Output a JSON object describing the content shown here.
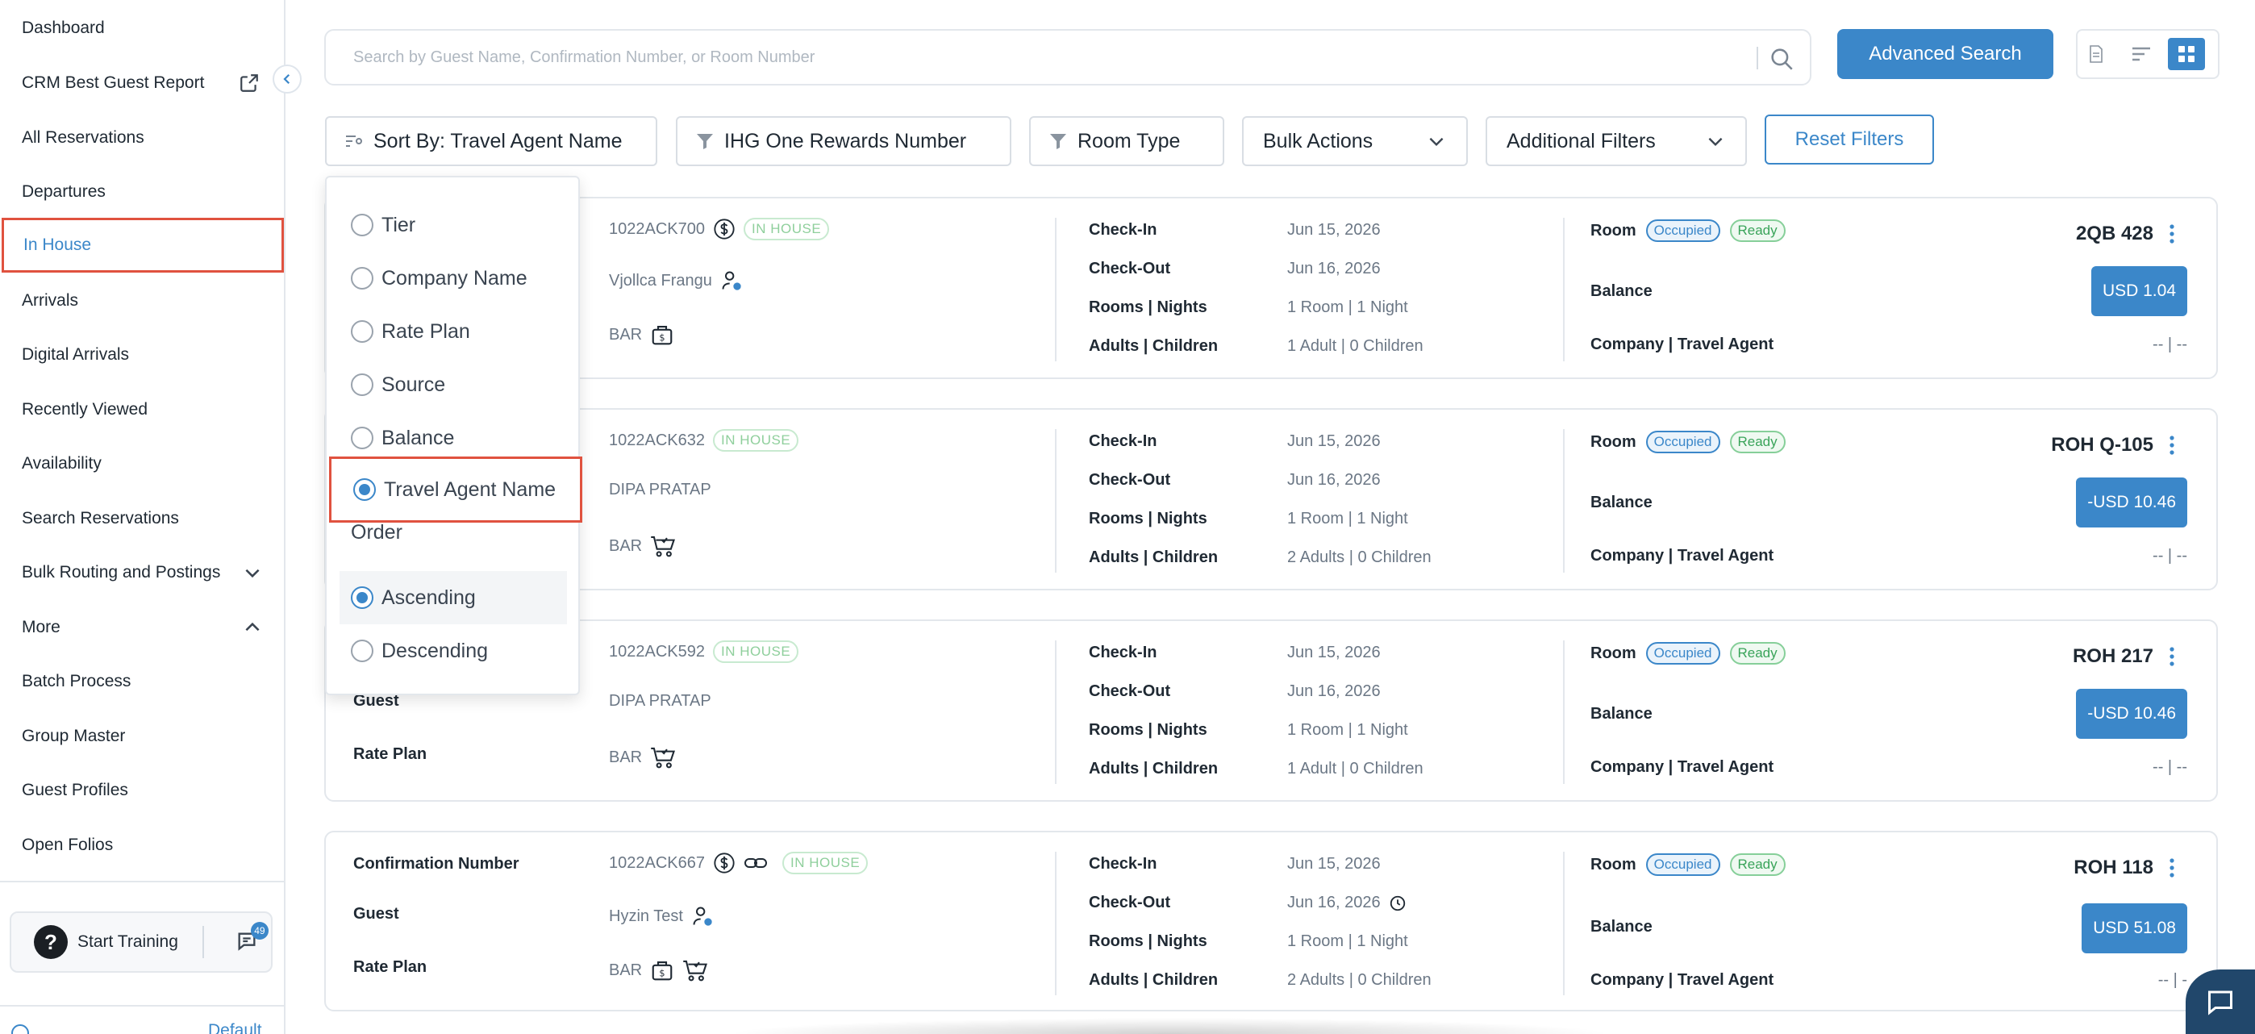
{
  "sidebar": {
    "items": [
      {
        "label": "Dashboard"
      },
      {
        "label": "CRM Best Guest Report"
      },
      {
        "label": "All Reservations"
      },
      {
        "label": "Departures"
      },
      {
        "label": "In House"
      },
      {
        "label": "Arrivals"
      },
      {
        "label": "Digital Arrivals"
      },
      {
        "label": "Recently Viewed"
      },
      {
        "label": "Availability"
      },
      {
        "label": "Search Reservations"
      },
      {
        "label": "Bulk Routing and Postings"
      },
      {
        "label": "More"
      },
      {
        "label": "Batch Process"
      },
      {
        "label": "Group Master"
      },
      {
        "label": "Guest Profiles"
      },
      {
        "label": "Open Folios"
      }
    ],
    "active": "In House",
    "training_label": "Start Training",
    "chat_badge": "49",
    "footer_default": "Default"
  },
  "search": {
    "placeholder": "Search by Guest Name, Confirmation Number, or Room Number",
    "advanced_label": "Advanced Search"
  },
  "filters": {
    "sort_label": "Sort By: Travel Agent Name",
    "rewards_label": "IHG One Rewards Number",
    "room_type_label": "Room Type",
    "bulk_actions_label": "Bulk Actions",
    "additional_filters_label": "Additional Filters",
    "reset_label": "Reset Filters"
  },
  "sort_panel": {
    "options": [
      "Tier",
      "Company Name",
      "Rate Plan",
      "Source",
      "Balance",
      "Travel Agent Name"
    ],
    "selected": "Travel Agent Name",
    "order_label": "Order",
    "order_options": [
      "Ascending",
      "Descending"
    ],
    "order_selected": "Ascending"
  },
  "labels": {
    "confirmation": "Confirmation Number",
    "guest": "Guest",
    "rate_plan": "Rate Plan",
    "check_in": "Check-In",
    "check_out": "Check-Out",
    "rooms_nights": "Rooms | Nights",
    "adults_children": "Adults | Children",
    "room": "Room",
    "balance": "Balance",
    "company_ta": "Company | Travel Agent",
    "in_house_tag": "IN HOUSE",
    "occupied_tag": "Occupied",
    "ready_tag": "Ready"
  },
  "reservations": [
    {
      "confirmation": "1022ACK700",
      "guest": "Vjollca Frangu",
      "rate_plan": "BAR",
      "check_in": "Jun 15, 2026",
      "check_out": "Jun 16, 2026",
      "rooms_nights": "1 Room | 1 Night",
      "adults_children": "1 Adult | 0 Children",
      "room": "2QB  428",
      "balance": "USD 1.04",
      "company_ta": "-- | --"
    },
    {
      "confirmation": "1022ACK632",
      "guest": "DIPA PRATAP",
      "rate_plan": "BAR",
      "check_in": "Jun 15, 2026",
      "check_out": "Jun 16, 2026",
      "rooms_nights": "1 Room | 1 Night",
      "adults_children": "2 Adults | 0 Children",
      "room": "ROH  Q-105",
      "balance": "-USD 10.46",
      "company_ta": "-- | --"
    },
    {
      "confirmation": "1022ACK592",
      "guest": "DIPA PRATAP",
      "rate_plan": "BAR",
      "check_in": "Jun 15, 2026",
      "check_out": "Jun 16, 2026",
      "rooms_nights": "1 Room | 1 Night",
      "adults_children": "1 Adult | 0 Children",
      "room": "ROH  217",
      "balance": "-USD 10.46",
      "company_ta": "-- | --"
    },
    {
      "confirmation": "1022ACK667",
      "guest": "Hyzin Test",
      "rate_plan": "BAR",
      "check_in": "Jun 15, 2026",
      "check_out": "Jun 16, 2026",
      "rooms_nights": "1 Room | 1 Night",
      "adults_children": "2 Adults | 0 Children",
      "room": "ROH  118",
      "balance": "USD 51.08",
      "company_ta": "-- | -"
    }
  ],
  "colors": {
    "accent": "#3b87c9",
    "highlight": "#e0523f",
    "in_house": "#8fcf9c",
    "ready": "#3aa45a"
  },
  "icons": [
    "search-icon",
    "external-link-icon",
    "chevron-left-icon",
    "chevron-down-icon",
    "chevron-up-icon",
    "filter-icon",
    "sort-icon",
    "dollar-icon",
    "link-icon",
    "guest-profile-icon",
    "rate-bag-icon",
    "cart-icon",
    "clock-icon",
    "kebab-icon",
    "chat-icon",
    "help-icon",
    "info-icon",
    "document-view-icon",
    "list-view-icon",
    "grid-view-icon"
  ]
}
